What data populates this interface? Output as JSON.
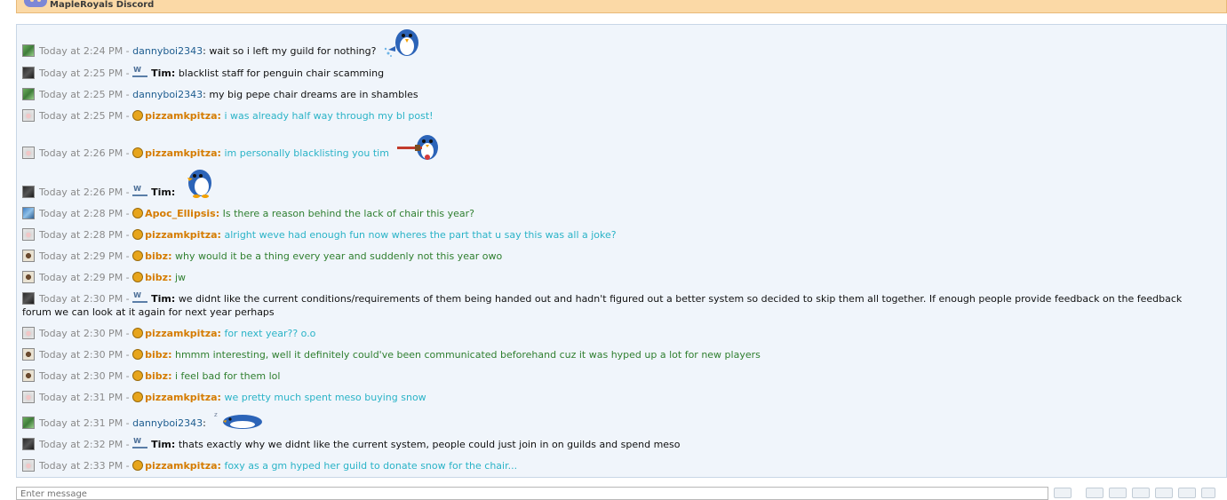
{
  "header": {
    "title": "MapleRoyals Discord",
    "icon": "discord-icon"
  },
  "input": {
    "placeholder": "Enter message"
  },
  "colors": {
    "pizzamkpitza_text": "#2ab3c7",
    "bibz_apoc_text": "#2f7f2f",
    "rank_name": "#d57c00",
    "discord_name": "#1d5c8f"
  },
  "messages": [
    {
      "time": "Today at 2:24 PM -",
      "name": "dannyboi2343",
      "sep": ":",
      "text": "wait so i left my guild for nothing?",
      "sticker": "penguin-sticker"
    },
    {
      "time": "Today at 2:25 PM -",
      "name": "Tim",
      "sep": ":",
      "text": "blacklist staff for penguin chair scamming"
    },
    {
      "time": "Today at 2:25 PM -",
      "name": "dannyboi2343",
      "sep": ":",
      "text": "my big pepe chair dreams are in shambles"
    },
    {
      "time": "Today at 2:25 PM -",
      "name": "pizzamkpitza",
      "sep": ":",
      "text": "i was already half way through my bl post!"
    },
    {
      "time": "Today at 2:26 PM -",
      "name": "pizzamkpitza",
      "sep": ":",
      "text": "im personally blacklisting you tim",
      "sticker": "penguin-sticker"
    },
    {
      "time": "Today at 2:26 PM -",
      "name": "Tim",
      "sep": ":",
      "text": "",
      "sticker": "penguin-sticker"
    },
    {
      "time": "Today at 2:28 PM -",
      "name": "Apoc_Ellipsis",
      "sep": ":",
      "text": "Is there a reason behind the lack of chair this year?"
    },
    {
      "time": "Today at 2:28 PM -",
      "name": "pizzamkpitza",
      "sep": ":",
      "text": "alright weve had enough fun now wheres the part that u say this was all a joke?"
    },
    {
      "time": "Today at 2:29 PM -",
      "name": "bibz",
      "sep": ":",
      "text": "why would it be a thing every year and suddenly not this year owo"
    },
    {
      "time": "Today at 2:29 PM -",
      "name": "bibz",
      "sep": ":",
      "text": "jw"
    },
    {
      "time": "Today at 2:30 PM -",
      "name": "Tim",
      "sep": ":",
      "text": "we didnt like the current conditions/requirements of them being handed out and hadn't figured out a better system so decided to skip them all together. If enough people provide feedback on the feedback forum we can look at it again for next year perhaps"
    },
    {
      "time": "Today at 2:30 PM -",
      "name": "pizzamkpitza",
      "sep": ":",
      "text": "for next year?? o.o"
    },
    {
      "time": "Today at 2:30 PM -",
      "name": "bibz",
      "sep": ":",
      "text": "hmmm interesting, well it definitely could've been communicated beforehand cuz it was hyped up a lot for new players"
    },
    {
      "time": "Today at 2:30 PM -",
      "name": "bibz",
      "sep": ":",
      "text": "i feel bad for them lol"
    },
    {
      "time": "Today at 2:31 PM -",
      "name": "pizzamkpitza",
      "sep": ":",
      "text": "we pretty much spent meso buying snow"
    },
    {
      "time": "Today at 2:31 PM -",
      "name": "dannyboi2343",
      "sep": ":",
      "text": "",
      "sticker": "penguin-sticker"
    },
    {
      "time": "Today at 2:32 PM -",
      "name": "Tim",
      "sep": ":",
      "text": "thats exactly why we didnt like the current system, people could just join in on guilds and spend meso"
    },
    {
      "time": "Today at 2:33 PM -",
      "name": "pizzamkpitza",
      "sep": ":",
      "text": "foxy as a gm hyped her guild to donate snow for the chair..."
    }
  ]
}
